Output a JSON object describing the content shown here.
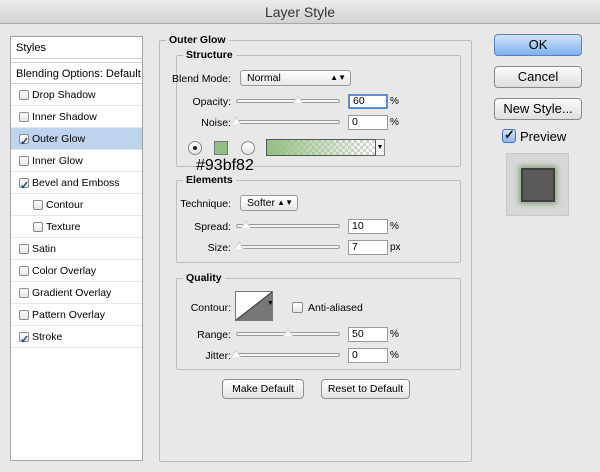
{
  "window": {
    "title": "Layer Style"
  },
  "sidebar": {
    "header": "Styles",
    "blending": "Blending Options: Default",
    "items": [
      {
        "label": "Drop Shadow",
        "checked": false,
        "indent": false,
        "selected": false
      },
      {
        "label": "Inner Shadow",
        "checked": false,
        "indent": false,
        "selected": false
      },
      {
        "label": "Outer Glow",
        "checked": true,
        "indent": false,
        "selected": true
      },
      {
        "label": "Inner Glow",
        "checked": false,
        "indent": false,
        "selected": false
      },
      {
        "label": "Bevel and Emboss",
        "checked": true,
        "indent": false,
        "selected": false
      },
      {
        "label": "Contour",
        "checked": false,
        "indent": true,
        "selected": false
      },
      {
        "label": "Texture",
        "checked": false,
        "indent": true,
        "selected": false
      },
      {
        "label": "Satin",
        "checked": false,
        "indent": false,
        "selected": false
      },
      {
        "label": "Color Overlay",
        "checked": false,
        "indent": false,
        "selected": false
      },
      {
        "label": "Gradient Overlay",
        "checked": false,
        "indent": false,
        "selected": false
      },
      {
        "label": "Pattern Overlay",
        "checked": false,
        "indent": false,
        "selected": false
      },
      {
        "label": "Stroke",
        "checked": true,
        "indent": false,
        "selected": false
      }
    ]
  },
  "outer_glow": {
    "title": "Outer Glow",
    "structure": {
      "title": "Structure",
      "blend_mode_label": "Blend Mode:",
      "blend_mode": "Normal",
      "opacity_label": "Opacity:",
      "opacity": "60",
      "opacity_fraction": 0.6,
      "opacity_unit": "%",
      "noise_label": "Noise:",
      "noise": "0",
      "noise_fraction": 0.0,
      "noise_unit": "%",
      "glow_color": "#93bf82",
      "color_hex_text": "#93bf82"
    },
    "elements": {
      "title": "Elements",
      "technique_label": "Technique:",
      "technique": "Softer",
      "spread_label": "Spread:",
      "spread": "10",
      "spread_fraction": 0.1,
      "spread_unit": "%",
      "size_label": "Size:",
      "size": "7",
      "size_fraction": 0.028,
      "size_unit": "px"
    },
    "quality": {
      "title": "Quality",
      "contour_label": "Contour:",
      "anti_aliased_label": "Anti-aliased",
      "range_label": "Range:",
      "range": "50",
      "range_fraction": 0.5,
      "range_unit": "%",
      "jitter_label": "Jitter:",
      "jitter": "0",
      "jitter_fraction": 0.0,
      "jitter_unit": "%"
    },
    "make_default": "Make Default",
    "reset_default": "Reset to Default"
  },
  "actions": {
    "ok": "OK",
    "cancel": "Cancel",
    "new_style": "New Style...",
    "preview": "Preview"
  }
}
